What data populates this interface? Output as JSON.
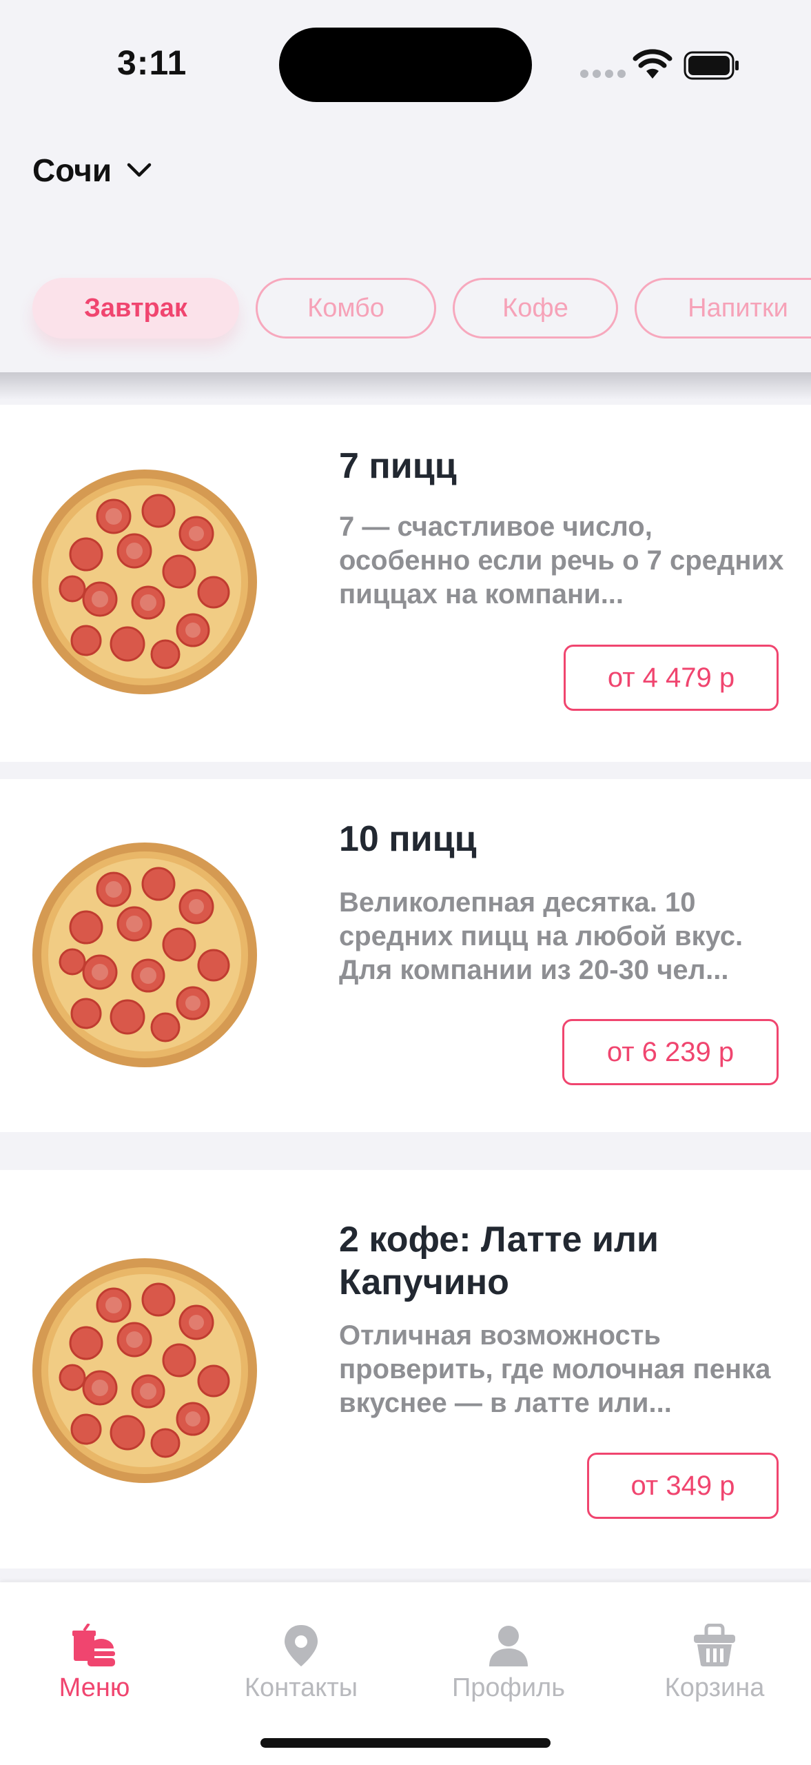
{
  "status_bar": {
    "time": "3:11"
  },
  "header": {
    "city": "Сочи"
  },
  "categories": [
    {
      "label": "Завтрак",
      "active": true
    },
    {
      "label": "Комбо",
      "active": false
    },
    {
      "label": "Кофе",
      "active": false
    },
    {
      "label": "Напитки",
      "active": false
    }
  ],
  "products": [
    {
      "title": "7 пицц",
      "description": "7 — счастливое число, особенно если речь о 7 средних пиццах на компани...",
      "price": "от 4 479 р"
    },
    {
      "title": "10 пицц",
      "description": "Великолепная десятка. 10 средних пицц на любой вкус. Для компании из 20-30 чел...",
      "price": "от 6 239 р"
    },
    {
      "title": "2 кофе: Латте или Капучино",
      "description": "Отличная возможность проверить, где молочная пенка вкуснее — в латте или...",
      "price": "от 349 р"
    }
  ],
  "tab_bar": {
    "items": [
      {
        "label": "Меню",
        "icon": "menu-icon",
        "active": true
      },
      {
        "label": "Контакты",
        "icon": "location-pin-icon",
        "active": false
      },
      {
        "label": "Профиль",
        "icon": "profile-icon",
        "active": false
      },
      {
        "label": "Корзина",
        "icon": "basket-icon",
        "active": false
      }
    ]
  },
  "colors": {
    "accent": "#f0456f",
    "inactive": "#b8b9bd",
    "background": "#f3f3f7"
  }
}
